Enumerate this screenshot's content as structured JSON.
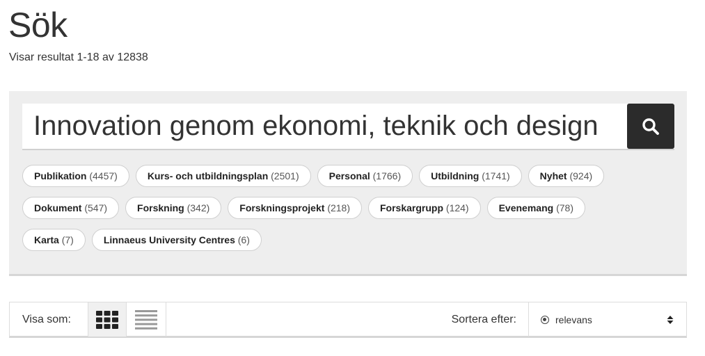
{
  "page": {
    "title": "Sök",
    "result_summary": "Visar resultat 1-18 av 12838"
  },
  "search": {
    "value": "Innovation genom ekonomi, teknik och design",
    "button_icon": "search-icon"
  },
  "facets": [
    {
      "name": "Publikation",
      "count": "(4457)"
    },
    {
      "name": "Kurs- och utbildningsplan",
      "count": "(2501)"
    },
    {
      "name": "Personal",
      "count": "(1766)"
    },
    {
      "name": "Utbildning",
      "count": "(1741)"
    },
    {
      "name": "Nyhet",
      "count": "(924)"
    },
    {
      "name": "Dokument",
      "count": "(547)"
    },
    {
      "name": "Forskning",
      "count": "(342)"
    },
    {
      "name": "Forskningsprojekt",
      "count": "(218)"
    },
    {
      "name": "Forskargrupp",
      "count": "(124)"
    },
    {
      "name": "Evenemang",
      "count": "(78)"
    },
    {
      "name": "Karta",
      "count": "(7)"
    },
    {
      "name": "Linnaeus University Centres",
      "count": "(6)"
    }
  ],
  "view": {
    "label": "Visa som:",
    "grid_icon": "grid-view-icon",
    "list_icon": "list-view-icon",
    "active": "grid"
  },
  "sort": {
    "label": "Sortera efter:",
    "selected": "relevans",
    "radio_icon": "radio-selected-icon",
    "arrows_icon": "sort-updown-icon"
  },
  "colors": {
    "panel_bg": "#eeeeee",
    "search_button_bg": "#2b2b2b",
    "text": "#222222"
  }
}
